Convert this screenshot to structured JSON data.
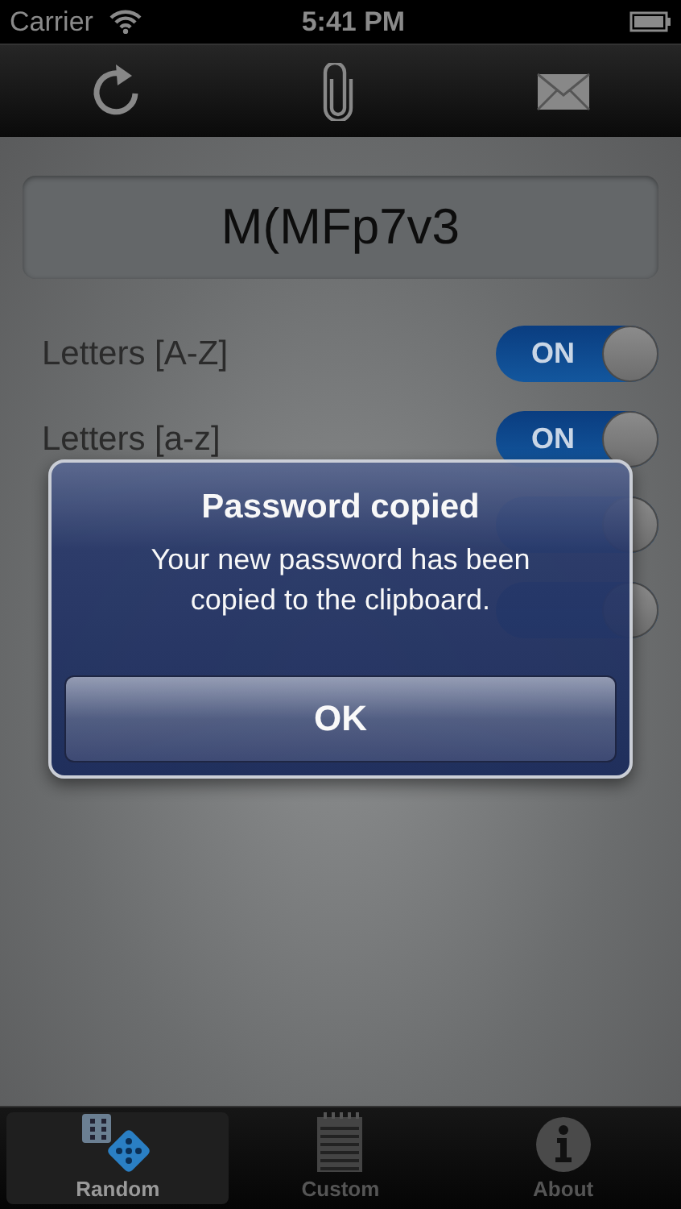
{
  "status_bar": {
    "carrier": "Carrier",
    "time": "5:41 PM"
  },
  "toolbar": {
    "buttons": [
      {
        "kind": "refresh"
      },
      {
        "kind": "clip"
      },
      {
        "kind": "mail"
      }
    ]
  },
  "password": {
    "value": "M(MFp7v3"
  },
  "options": [
    {
      "label": "Letters [A-Z]",
      "on": true,
      "state_text": "ON"
    },
    {
      "label": "Letters [a-z]",
      "on": true,
      "state_text": "ON"
    },
    {
      "on": true
    },
    {
      "on": true
    }
  ],
  "alert": {
    "title": "Password copied",
    "message": "Your new password has been copied to the clipboard.",
    "button": "OK"
  },
  "tabs": [
    {
      "label": "Random",
      "kind": "dice",
      "selected": true
    },
    {
      "label": "Custom",
      "kind": "notepad",
      "selected": false
    },
    {
      "label": "About",
      "kind": "info",
      "selected": false
    }
  ]
}
